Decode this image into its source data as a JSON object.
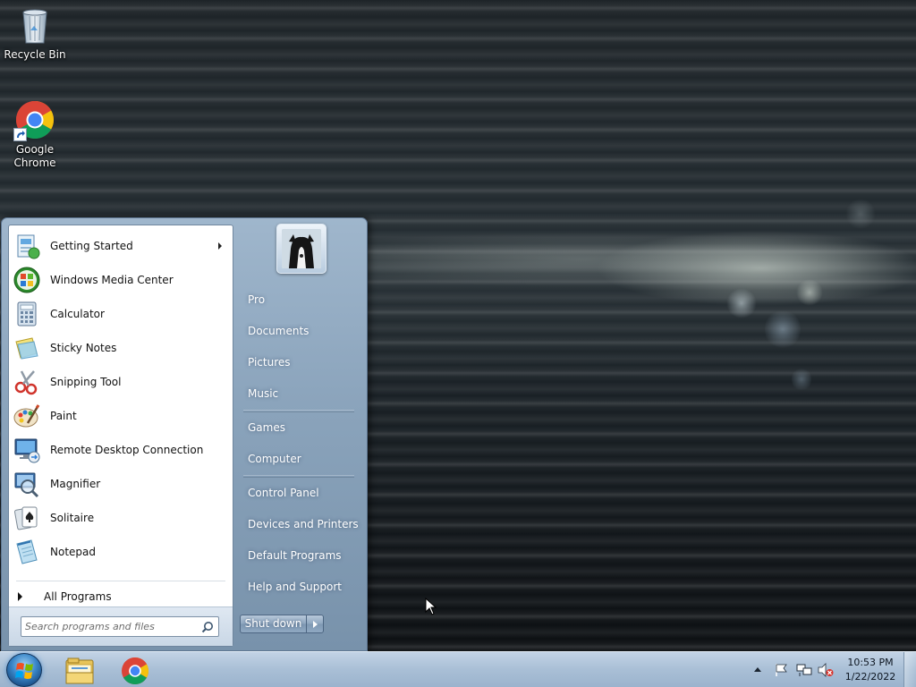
{
  "desktop": {
    "icons": [
      {
        "label": "Recycle Bin",
        "icon": "recycle-bin-icon"
      },
      {
        "label": "Google\nChrome",
        "label_line1": "Google",
        "label_line2": "Chrome",
        "icon": "chrome-icon"
      }
    ]
  },
  "start_menu": {
    "programs": [
      {
        "label": "Getting Started",
        "icon": "getting-started-icon",
        "has_submenu": true
      },
      {
        "label": "Windows Media Center",
        "icon": "windows-media-center-icon"
      },
      {
        "label": "Calculator",
        "icon": "calculator-icon"
      },
      {
        "label": "Sticky Notes",
        "icon": "sticky-notes-icon"
      },
      {
        "label": "Snipping Tool",
        "icon": "snipping-tool-icon"
      },
      {
        "label": "Paint",
        "icon": "paint-icon"
      },
      {
        "label": "Remote Desktop Connection",
        "icon": "remote-desktop-icon"
      },
      {
        "label": "Magnifier",
        "icon": "magnifier-icon"
      },
      {
        "label": "Solitaire",
        "icon": "solitaire-icon"
      },
      {
        "label": "Notepad",
        "icon": "notepad-icon"
      }
    ],
    "all_programs_label": "All Programs",
    "search_placeholder": "Search programs and files",
    "right_items": [
      {
        "label": "Pro"
      },
      {
        "label": "Documents"
      },
      {
        "label": "Pictures"
      },
      {
        "label": "Music"
      },
      {
        "label": "Games"
      },
      {
        "label": "Computer"
      },
      {
        "label": "Control Panel"
      },
      {
        "label": "Devices and Printers"
      },
      {
        "label": "Default Programs"
      },
      {
        "label": "Help and Support"
      }
    ],
    "shutdown_label": "Shut down"
  },
  "taskbar": {
    "pinned": [
      {
        "name": "Windows Explorer",
        "icon": "folder-icon"
      },
      {
        "name": "Google Chrome",
        "icon": "chrome-icon"
      }
    ],
    "tray_icons": [
      "show-hidden-icons-arrow",
      "action-center-flag-icon",
      "network-icon",
      "volume-muted-icon"
    ],
    "clock_time": "10:53 PM",
    "clock_date": "1/22/2022"
  },
  "colors": {
    "taskbar": "#a9bfd6",
    "start_menu_right": "#8aa3bb",
    "accent": "#3a86c8"
  }
}
